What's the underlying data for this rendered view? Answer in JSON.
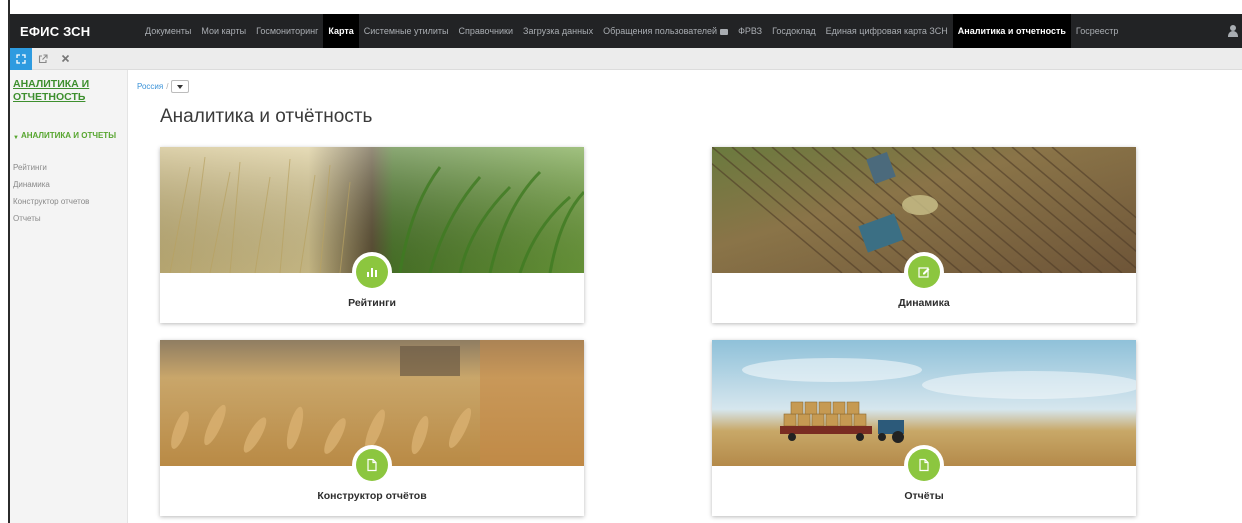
{
  "app": {
    "brand": "ЕФИС ЗСН"
  },
  "nav": {
    "items": [
      {
        "label": "Документы",
        "active": false
      },
      {
        "label": "Мои карты",
        "active": false
      },
      {
        "label": "Госмониторинг",
        "active": false
      },
      {
        "label": "Карта",
        "active": true
      },
      {
        "label": "Системные утилиты",
        "active": false
      },
      {
        "label": "Справочники",
        "active": false
      },
      {
        "label": "Загрузка данных",
        "active": false
      },
      {
        "label": "Обращения пользователей",
        "active": false
      },
      {
        "label": "ФРВЗ",
        "active": false
      },
      {
        "label": "Госдоклад",
        "active": false
      },
      {
        "label": "Единая цифровая карта ЗСН",
        "active": false
      },
      {
        "label": "Аналитика и отчетность",
        "active": true
      },
      {
        "label": "Госреестр",
        "active": false
      }
    ]
  },
  "toolbar": {
    "buttons": [
      "expand-icon",
      "external-link-icon",
      "close-icon"
    ]
  },
  "sidebar": {
    "title": "АНАЛИТИКА И ОТЧЕТНОСТЬ",
    "group": "АНАЛИТИКА И ОТЧЕТЫ",
    "links": [
      "Рейтинги",
      "Динамика",
      "Конструктор отчетов",
      "Отчеты"
    ]
  },
  "breadcrumb": {
    "root": "Россия",
    "separator": "/"
  },
  "page": {
    "title": "Аналитика и отчётность"
  },
  "cards": {
    "ratings": {
      "label": "Рейтинги",
      "icon": "bar-chart-icon"
    },
    "dynamics": {
      "label": "Динамика",
      "icon": "edit-icon"
    },
    "builder": {
      "label": "Конструктор отчётов",
      "icon": "document-icon"
    },
    "reports": {
      "label": "Отчёты",
      "icon": "document-icon"
    }
  },
  "colors": {
    "accent_green": "#8cc63f",
    "link_blue": "#3a92d8",
    "nav_bg": "#222325",
    "sidebar_green": "#3d8f2e"
  }
}
